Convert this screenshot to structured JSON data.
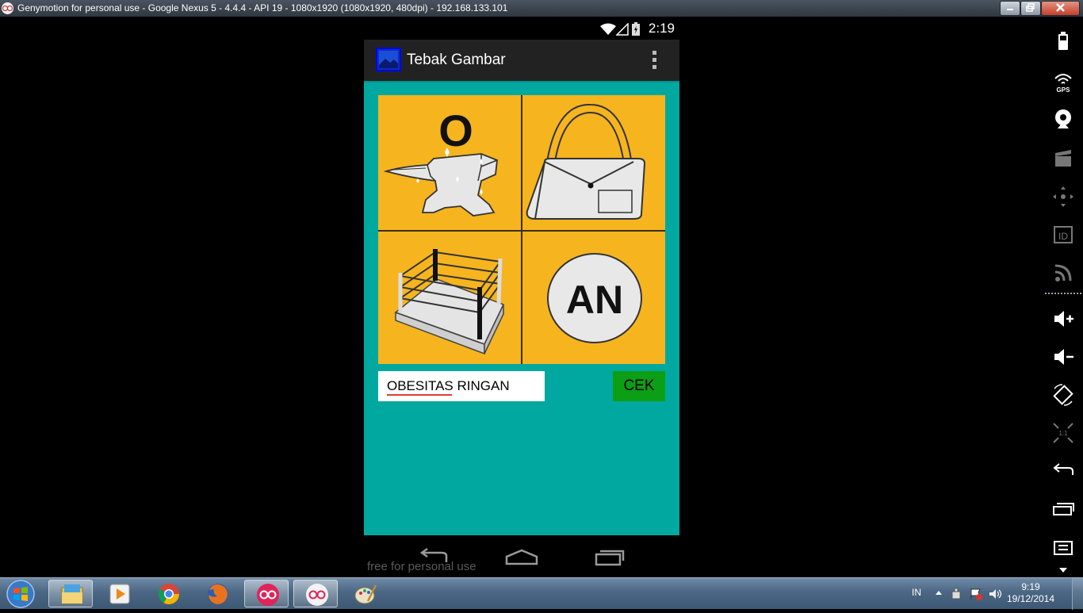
{
  "window": {
    "title": "Genymotion for personal use - Google Nexus 5 - 4.4.4 - API 19 - 1080x1920 (1080x1920, 480dpi) - 192.168.133.101"
  },
  "device": {
    "status_bar": {
      "time": "2:19"
    },
    "action_bar": {
      "title": "Tebak Gambar"
    },
    "puzzle": {
      "cells": [
        {
          "letter": "O",
          "picture": "anvil"
        },
        {
          "picture": "handbag"
        },
        {
          "picture": "boxing-ring"
        },
        {
          "letter": "AN",
          "picture": "circle"
        }
      ]
    },
    "answer_input": {
      "value": "OBESITAS RINGAN"
    },
    "cek_button": {
      "label": "CEK"
    },
    "watermark": "free for personal use"
  },
  "taskbar": {
    "language": "IN",
    "clock_time": "9:19",
    "clock_date": "19/12/2014",
    "pinned": [
      "windows-explorer",
      "media-player",
      "chrome",
      "firefox",
      "genymotion",
      "genymotion",
      "paint"
    ]
  },
  "colors": {
    "content_bg": "#00a8a0",
    "puzzle_bg": "#f6b41f",
    "cek_button": "#0c9e14"
  }
}
